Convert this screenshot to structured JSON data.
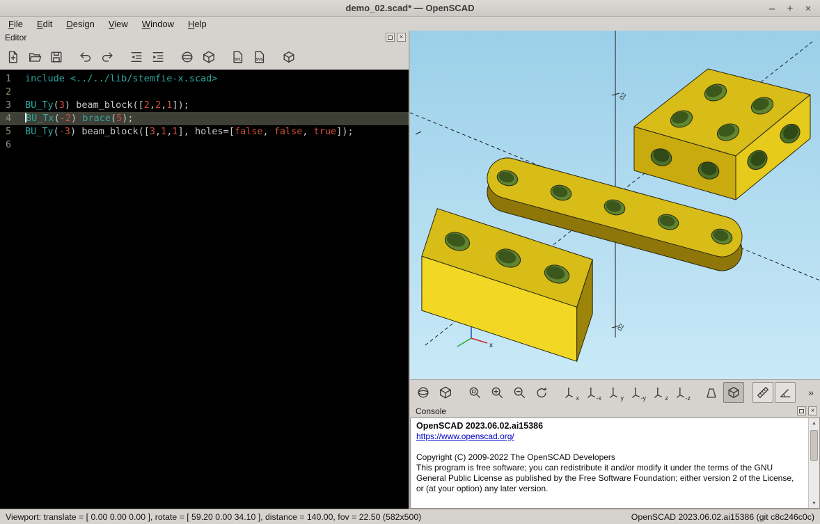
{
  "window": {
    "title": "demo_02.scad* — OpenSCAD",
    "controls": [
      {
        "name": "minimize",
        "glyph": "–"
      },
      {
        "name": "maximize",
        "glyph": "+"
      },
      {
        "name": "close",
        "glyph": "×"
      }
    ]
  },
  "menu": {
    "items": [
      "File",
      "Edit",
      "Design",
      "View",
      "Window",
      "Help"
    ]
  },
  "editor": {
    "panel_title": "Editor",
    "toolbar_groups": [
      [
        "new-file",
        "open-file",
        "save-file"
      ],
      [
        "undo",
        "redo"
      ],
      [
        "unindent",
        "indent"
      ],
      [
        "render-preview",
        "render"
      ],
      [
        "export-stl",
        "export-svg"
      ],
      [
        "export-3d"
      ]
    ],
    "active_line": 4,
    "lines": [
      {
        "no": 1,
        "tokens": [
          {
            "t": "include <../../lib/stemfie-x.scad>",
            "c": "kw"
          }
        ]
      },
      {
        "no": 2,
        "tokens": []
      },
      {
        "no": 3,
        "tokens": [
          {
            "t": "BU_Ty",
            "c": "kw"
          },
          {
            "t": "(",
            "c": "pl"
          },
          {
            "t": "3",
            "c": "num"
          },
          {
            "t": ") ",
            "c": "pl"
          },
          {
            "t": "beam_block",
            "c": "pl"
          },
          {
            "t": "([",
            "c": "pl"
          },
          {
            "t": "2",
            "c": "num"
          },
          {
            "t": ",",
            "c": "pl"
          },
          {
            "t": "2",
            "c": "num"
          },
          {
            "t": ",",
            "c": "pl"
          },
          {
            "t": "1",
            "c": "num"
          },
          {
            "t": "]);",
            "c": "pl"
          }
        ]
      },
      {
        "no": 4,
        "tokens": [
          {
            "t": "BU_Tx",
            "c": "kw"
          },
          {
            "t": "(",
            "c": "pl"
          },
          {
            "t": "-2",
            "c": "num"
          },
          {
            "t": ") ",
            "c": "pl"
          },
          {
            "t": "brace",
            "c": "kw"
          },
          {
            "t": "(",
            "c": "pl"
          },
          {
            "t": "5",
            "c": "num"
          },
          {
            "t": ");",
            "c": "pl"
          }
        ]
      },
      {
        "no": 5,
        "tokens": [
          {
            "t": "BU_Ty",
            "c": "kw"
          },
          {
            "t": "(",
            "c": "pl"
          },
          {
            "t": "-3",
            "c": "num"
          },
          {
            "t": ") ",
            "c": "pl"
          },
          {
            "t": "beam_block",
            "c": "pl"
          },
          {
            "t": "([",
            "c": "pl"
          },
          {
            "t": "3",
            "c": "num"
          },
          {
            "t": ",",
            "c": "pl"
          },
          {
            "t": "1",
            "c": "num"
          },
          {
            "t": ",",
            "c": "pl"
          },
          {
            "t": "1",
            "c": "num"
          },
          {
            "t": "], ",
            "c": "pl"
          },
          {
            "t": "holes",
            "c": "pl"
          },
          {
            "t": "=[",
            "c": "pl"
          },
          {
            "t": "false",
            "c": "num"
          },
          {
            "t": ", ",
            "c": "pl"
          },
          {
            "t": "false",
            "c": "num"
          },
          {
            "t": ", ",
            "c": "pl"
          },
          {
            "t": "true",
            "c": "num"
          },
          {
            "t": "]);",
            "c": "pl"
          }
        ]
      },
      {
        "no": 6,
        "tokens": []
      }
    ]
  },
  "viewport": {
    "tick_labels": [
      "02",
      "02"
    ],
    "mini_axis_label": "x"
  },
  "view_toolbar": {
    "buttons": [
      {
        "name": "render-preview"
      },
      {
        "name": "render"
      },
      {
        "name": "view-all",
        "gap": true
      },
      {
        "name": "zoom-in"
      },
      {
        "name": "zoom-out"
      },
      {
        "name": "reset-view"
      },
      {
        "name": "view-plus-x",
        "icon": "axis",
        "label": "x",
        "gap": true
      },
      {
        "name": "view-minus-x",
        "icon": "axis",
        "label": "-x"
      },
      {
        "name": "view-plus-y",
        "icon": "axis",
        "label": "y"
      },
      {
        "name": "view-minus-y",
        "icon": "axis",
        "label": "-y"
      },
      {
        "name": "view-plus-z",
        "icon": "axis",
        "label": "z"
      },
      {
        "name": "view-minus-z",
        "icon": "axis",
        "label": "-z"
      },
      {
        "name": "view-perspective",
        "gap": true
      },
      {
        "name": "view-orthogonal",
        "active": true
      },
      {
        "name": "measure-distance",
        "boxed": true,
        "gap": true
      },
      {
        "name": "measure-angle",
        "boxed": true
      },
      {
        "name": "toolbar-overflow",
        "text": "»",
        "end": true
      }
    ]
  },
  "console": {
    "panel_title": "Console",
    "lines": [
      {
        "text": "OpenSCAD 2023.06.02.ai15386",
        "style": "bold"
      },
      {
        "text": "https://www.openscad.org/",
        "style": "link"
      },
      {
        "text": "",
        "style": "blank"
      },
      {
        "text": "Copyright (C) 2009-2022 The OpenSCAD Developers",
        "style": "normal"
      },
      {
        "text": "This program is free software; you can redistribute it and/or modify it under the terms of the GNU General Public License as published by the Free Software Foundation; either version 2 of the License, or (at your option) any later version.",
        "style": "normal"
      }
    ]
  },
  "statusbar": {
    "left": "Viewport: translate = [ 0.00 0.00 0.00 ], rotate = [ 59.20 0.00 34.10 ], distance = 140.00, fov = 22.50 (582x500)",
    "right": "OpenSCAD 2023.06.02.ai15386 (git c8c246c0c)"
  },
  "colors": {
    "code-kw": "#2fa8a0",
    "code-num": "#cf4f38",
    "code-plain": "#c9c9c9",
    "active-line-bg": "#3e3f36",
    "vp-bg1": "#9bcfe9",
    "vp-bg2": "#c9e9f7",
    "part-top": "#d8bc17",
    "part-bright": "#f2d824",
    "part-mid": "#c9ab10",
    "part-dark": "#9c8309",
    "part-side2": "#8e7708",
    "part-right": "#e6ca1c",
    "hole": "#5f8530",
    "hole-dark": "#3b571c",
    "hole-side": "#4c7026",
    "hole-side-dark": "#2f4a17",
    "edge": "#26260f"
  }
}
